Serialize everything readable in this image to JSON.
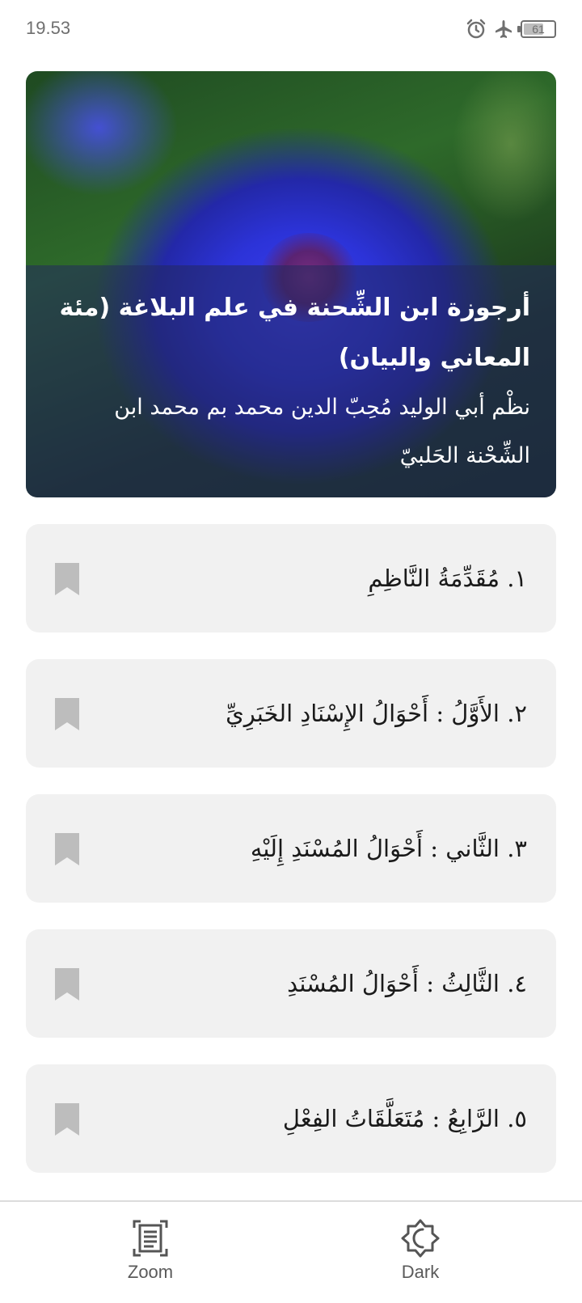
{
  "status_bar": {
    "time": "19.53",
    "battery": "61",
    "battery_level": 0.61,
    "icons": [
      "alarm-icon",
      "airplane-mode-icon",
      "battery-icon"
    ]
  },
  "hero": {
    "title": "أرجوزة ابن الشِّحنة في علم البلاغة (مئة المعاني والبيان)",
    "subtitle": "نظْم أبي الوليد مُحِبّ الدين محمد بم محمد ابن الشِّحْنة الحَلبيّ"
  },
  "chapters": [
    {
      "label": "١. مُقَدِّمَةُ النَّاظِمِ"
    },
    {
      "label": "٢. الأَوَّلُ : أَحْوَالُ الإِسْنَادِ الخَبَرِيِّ"
    },
    {
      "label": "٣. الثَّاني : أَحْوَالُ المُسْنَدِ إِلَيْهِ"
    },
    {
      "label": "٤. الثَّالِثُ : أَحْوَالُ المُسْنَدِ"
    },
    {
      "label": "٥. الرَّابِعُ : مُتَعَلَّقَاتُ الفِعْلِ"
    }
  ],
  "bottom_nav": {
    "zoom_label": "Zoom",
    "dark_label": "Dark"
  },
  "colors": {
    "card_bg": "#f1f1f1",
    "bookmark": "#bdbdbd",
    "hero_overlay": "#23285f"
  }
}
